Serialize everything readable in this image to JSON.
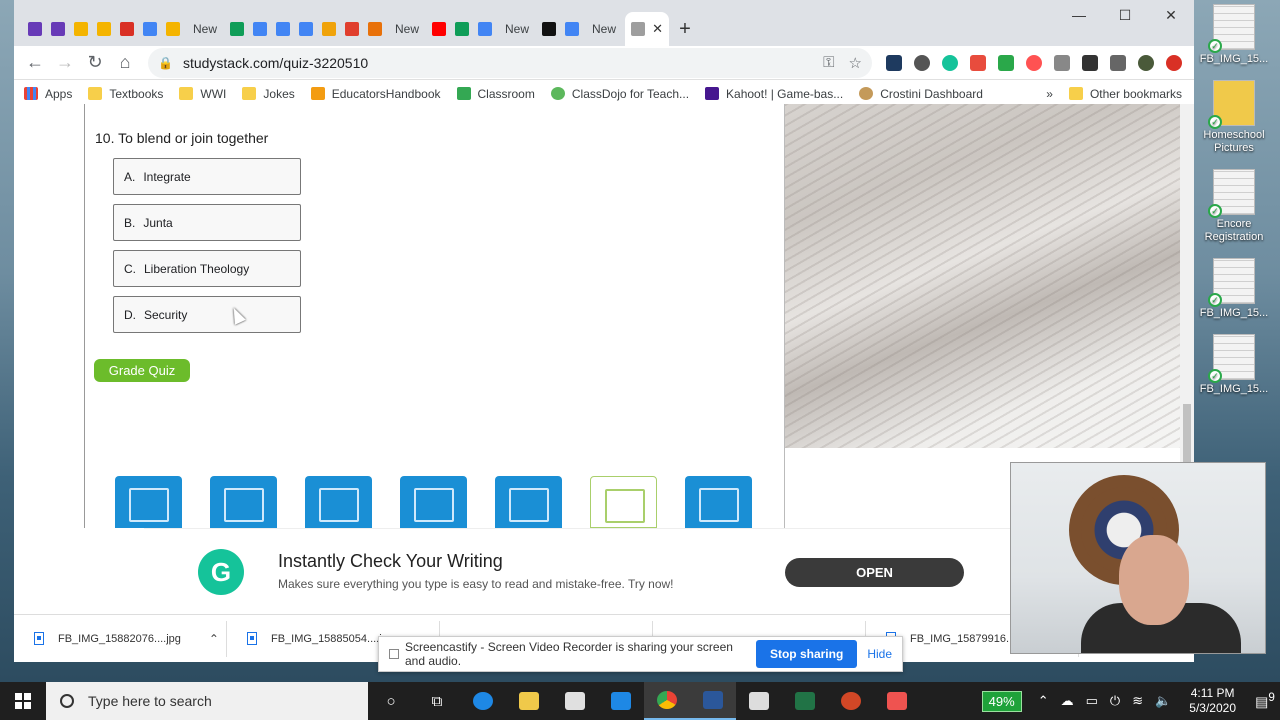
{
  "browser": {
    "tab_new_label": "New",
    "url": "studystack.com/quiz-3220510",
    "bookmarks": [
      {
        "label": "Apps"
      },
      {
        "label": "Textbooks"
      },
      {
        "label": "WWI"
      },
      {
        "label": "Jokes"
      },
      {
        "label": "EducatorsHandbook"
      },
      {
        "label": "Classroom"
      },
      {
        "label": "ClassDojo for Teach..."
      },
      {
        "label": "Kahoot! | Game-bas..."
      },
      {
        "label": "Crostini Dashboard"
      }
    ],
    "other_bookmarks": "Other bookmarks"
  },
  "quiz": {
    "question": "10. To blend or join together",
    "answers": [
      {
        "letter": "A.",
        "text": "Integrate"
      },
      {
        "letter": "B.",
        "text": "Junta"
      },
      {
        "letter": "C.",
        "text": "Liberation Theology"
      },
      {
        "letter": "D.",
        "text": "Security"
      }
    ],
    "grade_button": "Grade Quiz"
  },
  "ad": {
    "title": "Instantly Check Your Writing",
    "subtitle": "Makes sure everything you type is easy to read and mistake-free. Try now!",
    "open_button": "OPEN"
  },
  "downloads": [
    {
      "name": "FB_IMG_15882076....jpg"
    },
    {
      "name": "FB_IMG_15885054....jpg"
    },
    {
      "name": "FB_IMG_15879916...."
    }
  ],
  "screencastify": {
    "message": "Screencastify - Screen Video Recorder is sharing your screen and audio.",
    "stop_button": "Stop sharing",
    "hide_link": "Hide"
  },
  "desktop_icons": [
    {
      "label": "FB_IMG_15..."
    },
    {
      "label": "Homeschool Pictures"
    },
    {
      "label": "Encore Registration"
    },
    {
      "label": "FB_IMG_15..."
    },
    {
      "label": "FB_IMG_15..."
    }
  ],
  "taskbar": {
    "search_placeholder": "Type here to search",
    "battery": "49%",
    "time": "4:11 PM",
    "date": "5/3/2020",
    "notification_count": "9"
  },
  "colors": {
    "grade_green": "#6cbc2b",
    "tool_blue": "#1a8fd5",
    "grammarly_green": "#15c39a",
    "stop_blue": "#1a73e8"
  }
}
